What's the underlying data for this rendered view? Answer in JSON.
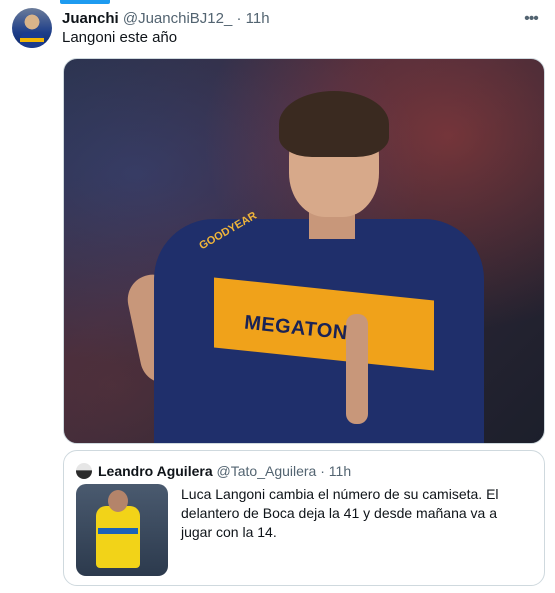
{
  "tweet": {
    "author_name": "Juanchi",
    "author_handle": "@JuanchiBJ12_",
    "separator": "·",
    "time": "11h",
    "text": "Langoni este año",
    "more_icon": "ellipsis-icon",
    "media_alt": "Player in Boca Juniors jersey",
    "media_jersey_brand": "GOODYEAR",
    "media_sponsor": "MEGATON"
  },
  "quote": {
    "author_name": "Leandro Aguilera",
    "author_handle": "@Tato_Aguilera",
    "separator": "·",
    "time": "11h",
    "text": "Luca Langoni cambia el número de su camiseta. El delantero de Boca deja la 41 y desde mañana va a jugar con la 14."
  },
  "colors": {
    "accent": "#1d9bf0",
    "secondary_text": "#536471",
    "border": "#cfd9de"
  }
}
